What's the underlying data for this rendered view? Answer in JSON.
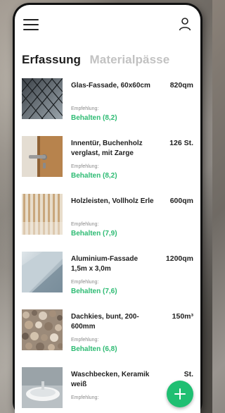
{
  "header": {
    "menu_icon": "hamburger-menu-icon",
    "user_icon": "user-icon"
  },
  "tabs": [
    {
      "label": "Erfassung",
      "active": true
    },
    {
      "label": "Materialpässe",
      "active": false
    }
  ],
  "recommendation_label": "Empfehlung:",
  "items": [
    {
      "name": "Glas-Fassade, 60x60cm",
      "quantity": "820qm",
      "recommendation": "Behalten (8,2)",
      "thumb": "glass-facade"
    },
    {
      "name": "Innentür, Buchenholz verglast, mit Zarge",
      "quantity": "126 St.",
      "recommendation": "Behalten (8,2)",
      "thumb": "door-handle"
    },
    {
      "name": "Holzleisten, Vollholz Erle",
      "quantity": "600qm",
      "recommendation": "Behalten (7,9)",
      "thumb": "wood-slats"
    },
    {
      "name": "Aluminium-Fassade 1,5m x 3,0m",
      "quantity": "1200qm",
      "recommendation": "Behalten (7,6)",
      "thumb": "aluminium-facade"
    },
    {
      "name": "Dachkies, bunt, 200-600mm",
      "quantity": "150m³",
      "recommendation": "Behalten (6,8)",
      "thumb": "gravel"
    },
    {
      "name": "Waschbecken, Keramik weiß",
      "quantity": "St.",
      "recommendation": "",
      "thumb": "washbasin"
    }
  ],
  "fab_icon": "plus-icon",
  "colors": {
    "accent": "#1fbf72",
    "recommendation": "#2dbb73",
    "inactive_tab": "#c2c2c2"
  }
}
